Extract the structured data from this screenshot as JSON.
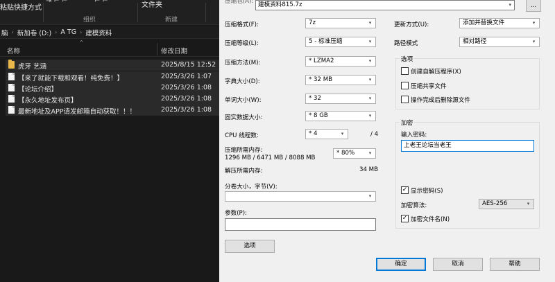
{
  "explorer": {
    "ribbon_items": {
      "pin_quick_access": "粘贴快捷方式",
      "folder_partial": "文件夹"
    },
    "ribbon_groups": {
      "organize": "组织",
      "new": "新建"
    },
    "breadcrumb": [
      "脑",
      "新加卷 (D:)",
      "A TG",
      "建模资料"
    ],
    "columns": {
      "name": "名称",
      "date": "修改日期"
    },
    "files": [
      {
        "name": "虎牙 艺涵",
        "date": "2025/8/15 12:52",
        "icon": "folder-icon"
      },
      {
        "name": "【来了就能下载和观看！纯免费！】",
        "date": "2025/3/26 1:07",
        "icon": "document-icon"
      },
      {
        "name": "【论坛介绍】",
        "date": "2025/3/26 1:08",
        "icon": "document-icon"
      },
      {
        "name": "【永久地址发布页】",
        "date": "2025/3/26 1:08",
        "icon": "document-icon"
      },
      {
        "name": "最新地址及APP请发邮箱自动获取！！！",
        "date": "2025/3/26 1:08",
        "icon": "document-icon"
      }
    ]
  },
  "dialog": {
    "archive_name": "建模资料815.7z",
    "browse_button": "...",
    "labels": {
      "format": "压缩格式(F):",
      "level": "压缩等级(L):",
      "method": "压缩方法(M):",
      "dict": "字典大小(D):",
      "word": "单词大小(W):",
      "solid": "固实数据大小:",
      "threads": "CPU 线程数:",
      "threads_total": "/ 4",
      "mem_compress": "压缩所需内存:",
      "mem_compress_value": "1296 MB / 6471 MB / 8088 MB",
      "mem_decompress": "解压所需内存:",
      "mem_decompress_value": "34 MB",
      "split": "分卷大小，字节(V):",
      "params": "参数(P):",
      "update_mode": "更新方式(U):",
      "path_mode": "路径模式"
    },
    "values": {
      "format": "7z",
      "level": "5 - 标准压缩",
      "method": "* LZMA2",
      "dict": "* 32 MB",
      "word": "* 32",
      "solid": "* 8 GB",
      "threads": "* 4",
      "mem_percent": "* 80%",
      "split": "",
      "params": "",
      "update_mode": "添加并替换文件",
      "path_mode": "相对路径"
    },
    "options": {
      "title": "选项",
      "sfx": "创建自解压程序(X)",
      "shared": "压缩共享文件",
      "delete_after": "操作完成后删除源文件"
    },
    "encryption": {
      "title": "加密",
      "enter_password": "输入密码:",
      "password": "上老王论坛当老王",
      "show_password": "显示密码(S)",
      "method_label": "加密算法:",
      "method": "AES-256",
      "encrypt_names": "加密文件名(N)"
    },
    "buttons": {
      "options": "选项",
      "ok": "确定",
      "cancel": "取消",
      "help": "帮助"
    }
  }
}
